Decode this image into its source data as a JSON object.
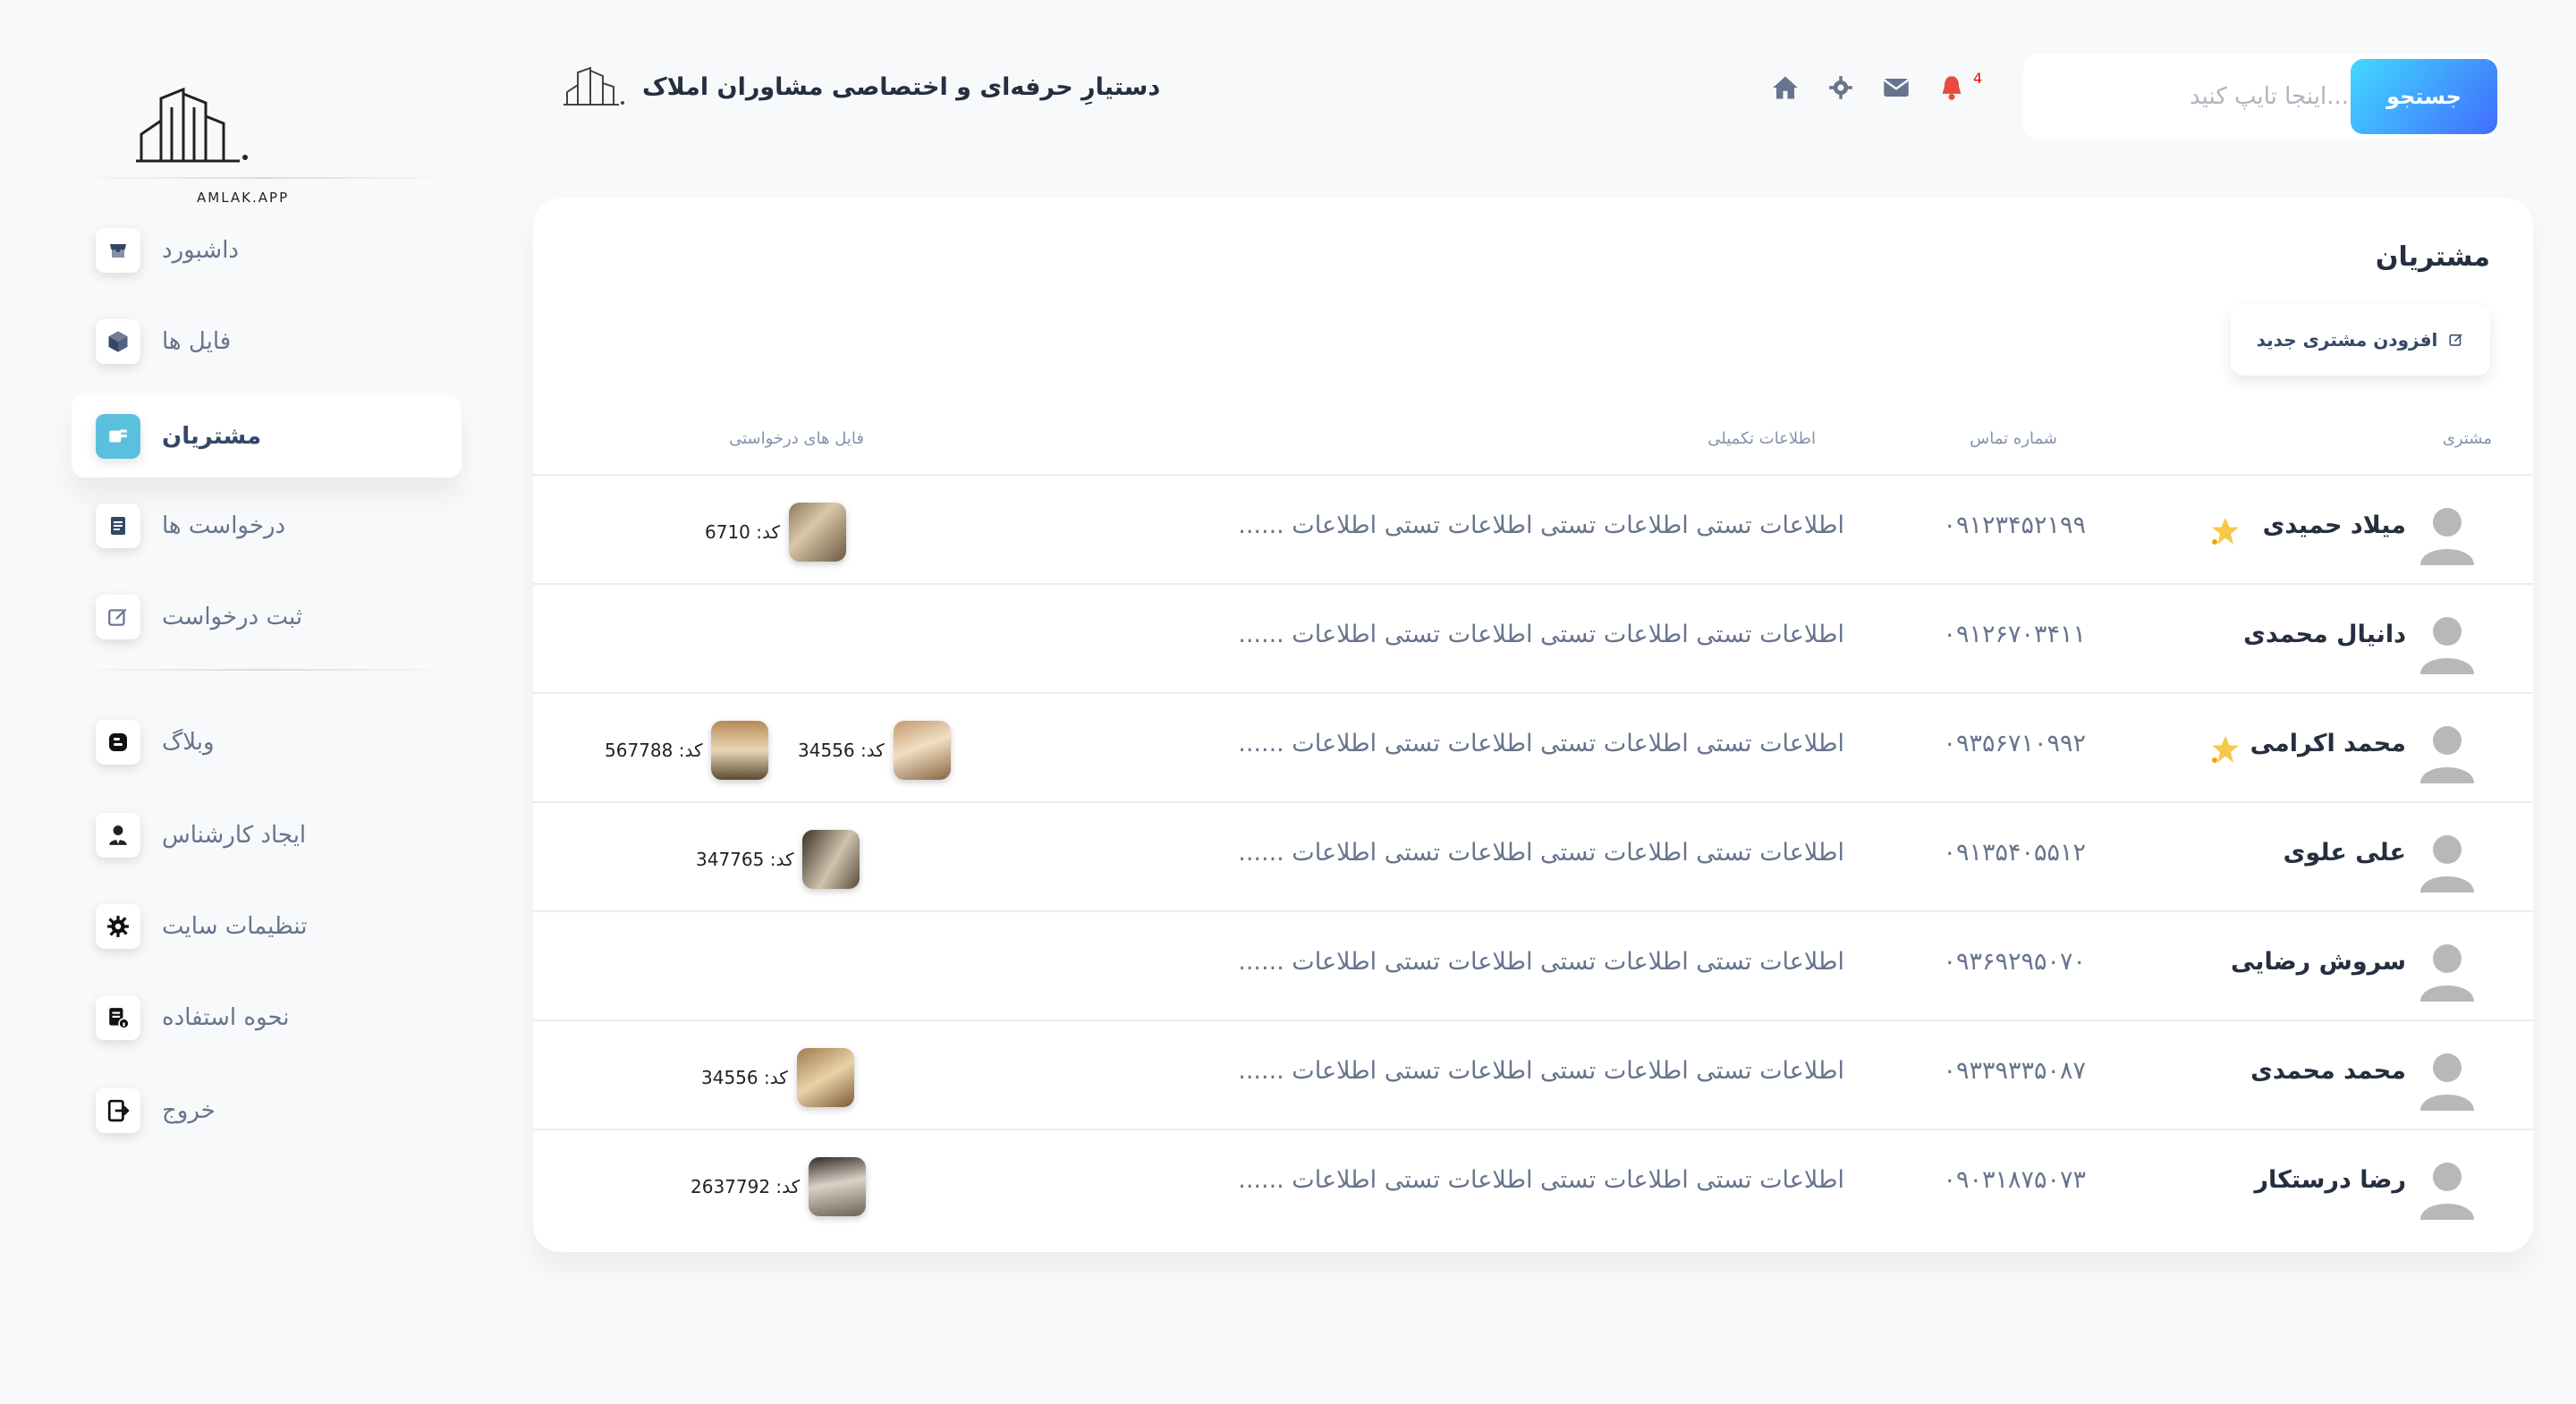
{
  "logo": {
    "text": "AMLAK.APP"
  },
  "brand": {
    "title": "دستیارِ حرفه‌ای و اختصاصی مشاوران املاک"
  },
  "header": {
    "notification_count": "4",
    "search_placeholder": "...اینجا تایپ کنید",
    "search_button": "جستجو"
  },
  "sidebar": {
    "items": [
      {
        "label": "داشبورد",
        "icon": "shop-icon"
      },
      {
        "label": "فایل ها",
        "icon": "box-icon"
      },
      {
        "label": "مشتریان",
        "icon": "customers-icon",
        "active": true
      },
      {
        "label": "درخواست ها",
        "icon": "document-icon"
      },
      {
        "label": "ثبت درخواست",
        "icon": "edit-icon"
      },
      {
        "label": "وبلاگ",
        "icon": "blog-icon"
      },
      {
        "label": "ایجاد کارشناس",
        "icon": "user-tie-icon"
      },
      {
        "label": "تنظیمات سایت",
        "icon": "gear-icon"
      },
      {
        "label": "نحوه استفاده",
        "icon": "guide-icon"
      },
      {
        "label": "خروج",
        "icon": "logout-icon"
      }
    ]
  },
  "main": {
    "title": "مشتریان",
    "add_button": "افزودن مشتری جدید",
    "columns": {
      "customer": "مشتری",
      "phone": "شماره تماس",
      "info": "اطلاعات تکمیلی",
      "files": "فایل های درخواستی"
    },
    "rows": [
      {
        "name": "میلاد حمیدی",
        "starred": true,
        "phone": "۰۹۱۲۳۴۵۲۱۹۹",
        "info": "اطلاعات تستی اطلاعات تستی اطلاعات تستی اطلاعات ......",
        "files": [
          {
            "code": "کد: 6710"
          }
        ]
      },
      {
        "name": "دانیال محمدی",
        "starred": false,
        "phone": "۰۹۱۲۶۷۰۳۴۱۱",
        "info": "اطلاعات تستی اطلاعات تستی اطلاعات تستی اطلاعات ......",
        "files": []
      },
      {
        "name": "محمد اکرامی",
        "starred": true,
        "phone": "۰۹۳۵۶۷۱۰۹۹۲",
        "info": "اطلاعات تستی اطلاعات تستی اطلاعات تستی اطلاعات ......",
        "files": [
          {
            "code": "کد: 34556"
          },
          {
            "code": "کد: 567788"
          }
        ]
      },
      {
        "name": "علی علوی",
        "starred": false,
        "phone": "۰۹۱۳۵۴۰۵۵۱۲",
        "info": "اطلاعات تستی اطلاعات تستی اطلاعات تستی اطلاعات ......",
        "files": [
          {
            "code": "کد: 347765"
          }
        ]
      },
      {
        "name": "سروش رضایی",
        "starred": false,
        "phone": "۰۹۳۶۹۲۹۵۰۷۰",
        "info": "اطلاعات تستی اطلاعات تستی اطلاعات تستی اطلاعات ......",
        "files": []
      },
      {
        "name": "محمد محمدی",
        "starred": false,
        "phone": "۰۹۳۳۹۳۳۵۰۸۷",
        "info": "اطلاعات تستی اطلاعات تستی اطلاعات تستی اطلاعات ......",
        "files": [
          {
            "code": "کد: 34556"
          }
        ]
      },
      {
        "name": "رضا درستکار",
        "starred": false,
        "phone": "۰۹۰۳۱۸۷۵۰۷۳",
        "info": "اطلاعات تستی اطلاعات تستی اطلاعات تستی اطلاعات ......",
        "files": [
          {
            "code": "کد: 2637792"
          }
        ]
      }
    ]
  }
}
